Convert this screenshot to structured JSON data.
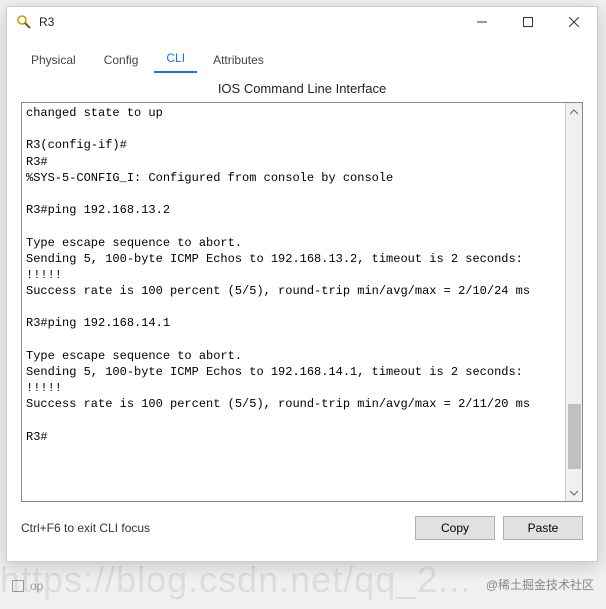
{
  "window": {
    "title": "R3"
  },
  "tabs": [
    {
      "label": "Physical",
      "active": false
    },
    {
      "label": "Config",
      "active": false
    },
    {
      "label": "CLI",
      "active": true
    },
    {
      "label": "Attributes",
      "active": false
    }
  ],
  "section_title": "IOS Command Line Interface",
  "terminal_text": "changed state to up\n\nR3(config-if)#\nR3#\n%SYS-5-CONFIG_I: Configured from console by console\n\nR3#ping 192.168.13.2\n\nType escape sequence to abort.\nSending 5, 100-byte ICMP Echos to 192.168.13.2, timeout is 2 seconds:\n!!!!!\nSuccess rate is 100 percent (5/5), round-trip min/avg/max = 2/10/24 ms\n\nR3#ping 192.168.14.1\n\nType escape sequence to abort.\nSending 5, 100-byte ICMP Echos to 192.168.14.1, timeout is 2 seconds:\n!!!!!\nSuccess rate is 100 percent (5/5), round-trip min/avg/max = 2/11/20 ms\n\nR3#",
  "footer": {
    "hint": "Ctrl+F6 to exit CLI focus",
    "copy": "Copy",
    "paste": "Paste"
  },
  "watermark": {
    "bg": "https://blog.csdn.net/qq_2...",
    "zh": "@稀土掘金技术社区",
    "check_label": "op"
  }
}
